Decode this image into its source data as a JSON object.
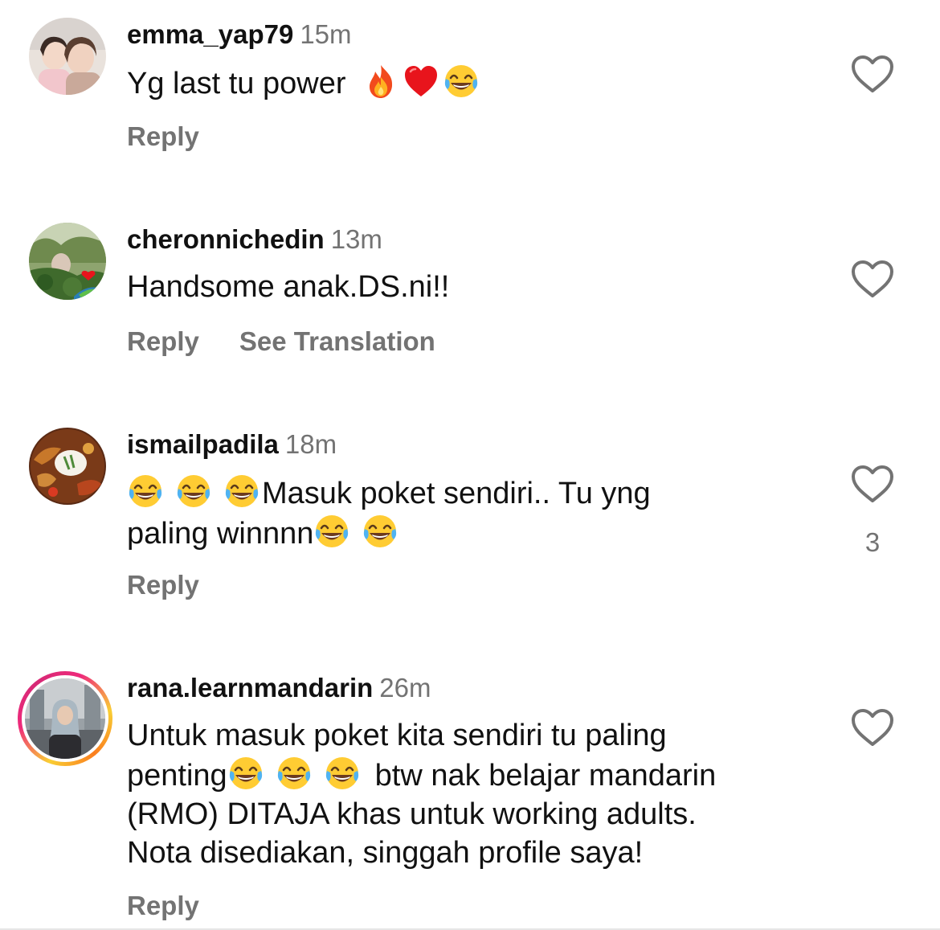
{
  "comments": [
    {
      "username": "emma_yap79",
      "time": "15m",
      "text": "Yg last tu power",
      "emojis": [
        "fire-emoji",
        "red-heart-emoji",
        "tears-of-joy-emoji"
      ],
      "reply_label": "Reply",
      "avatar": "profile-photo"
    },
    {
      "username": "cheronnichedin",
      "time": "13m",
      "text": "Handsome anak.DS.ni!!",
      "reply_label": "Reply",
      "translation_label": "See Translation",
      "avatar": "profile-photo"
    },
    {
      "username": "ismailpadila",
      "time": "18m",
      "text_line1": "Masuk poket sendiri.. Tu yng",
      "text_line2": "paling winnnn",
      "like_count": "3",
      "reply_label": "Reply",
      "avatar": "profile-photo"
    },
    {
      "username": "rana.learnmandarin",
      "time": "26m",
      "text_line1": "Untuk masuk poket kita sendiri tu paling",
      "text_line2a": "penting",
      "text_line2b": "btw nak belajar mandarin",
      "text_line3": "(RMO) DITAJA khas untuk working adults.",
      "text_line4": "Nota disediakan, singgah profile saya!",
      "reply_label": "Reply",
      "avatar": "profile-photo-with-story-ring"
    }
  ],
  "icons": {
    "like": "heart-outline-icon"
  },
  "colors": {
    "text": "#111111",
    "muted": "#737373",
    "story_ring_start": "#f9ce34",
    "story_ring_end": "#ee2a7b"
  }
}
